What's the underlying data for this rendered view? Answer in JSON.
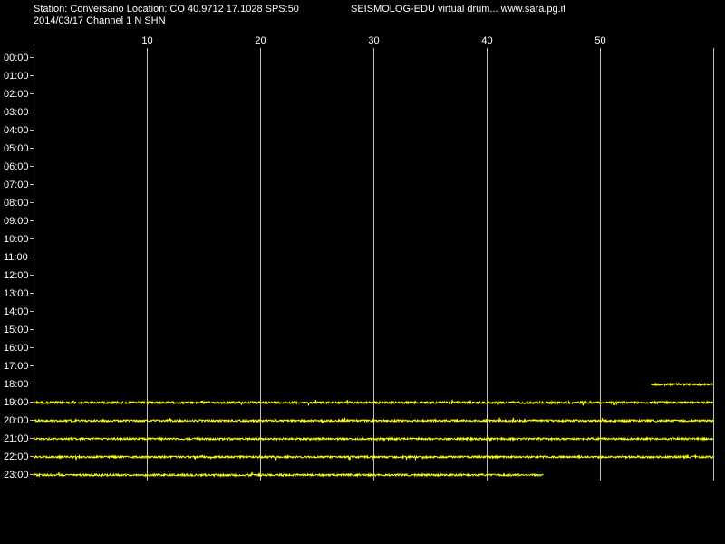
{
  "header": {
    "station": "Station: Conversano Location: CO 40.9712 17.1028 SPS:50",
    "program": "SEISMOLOG-EDU virtual drum... www.sara.pg.it",
    "date_channel": "2014/03/17  Channel 1 N SHN"
  },
  "colors": {
    "background": "#000000",
    "trace": "#ffff00",
    "grid": "#c0c0c0",
    "text": "#ffffff"
  },
  "chart_data": {
    "type": "line",
    "title": "",
    "xlabel": "",
    "ylabel": "",
    "xlim": [
      0,
      60
    ],
    "x_ticks": [
      "10",
      "20",
      "30",
      "40",
      "50"
    ],
    "x_tick_values": [
      10,
      20,
      30,
      40,
      50
    ],
    "grid": true,
    "row_labels": [
      "00:00",
      "01:00",
      "02:00",
      "03:00",
      "04:00",
      "05:00",
      "06:00",
      "07:00",
      "08:00",
      "09:00",
      "10:00",
      "11:00",
      "12:00",
      "13:00",
      "14:00",
      "15:00",
      "16:00",
      "17:00",
      "18:00",
      "19:00",
      "20:00",
      "21:00",
      "22:00",
      "23:00"
    ],
    "traces": [
      {
        "row": "18:00",
        "start_min": 54.5,
        "end_min": 60
      },
      {
        "row": "19:00",
        "start_min": 0,
        "end_min": 60
      },
      {
        "row": "20:00",
        "start_min": 0,
        "end_min": 60
      },
      {
        "row": "21:00",
        "start_min": 0,
        "end_min": 60
      },
      {
        "row": "22:00",
        "start_min": 0,
        "end_min": 60
      },
      {
        "row": "23:00",
        "start_min": 0,
        "end_min": 45
      }
    ]
  }
}
